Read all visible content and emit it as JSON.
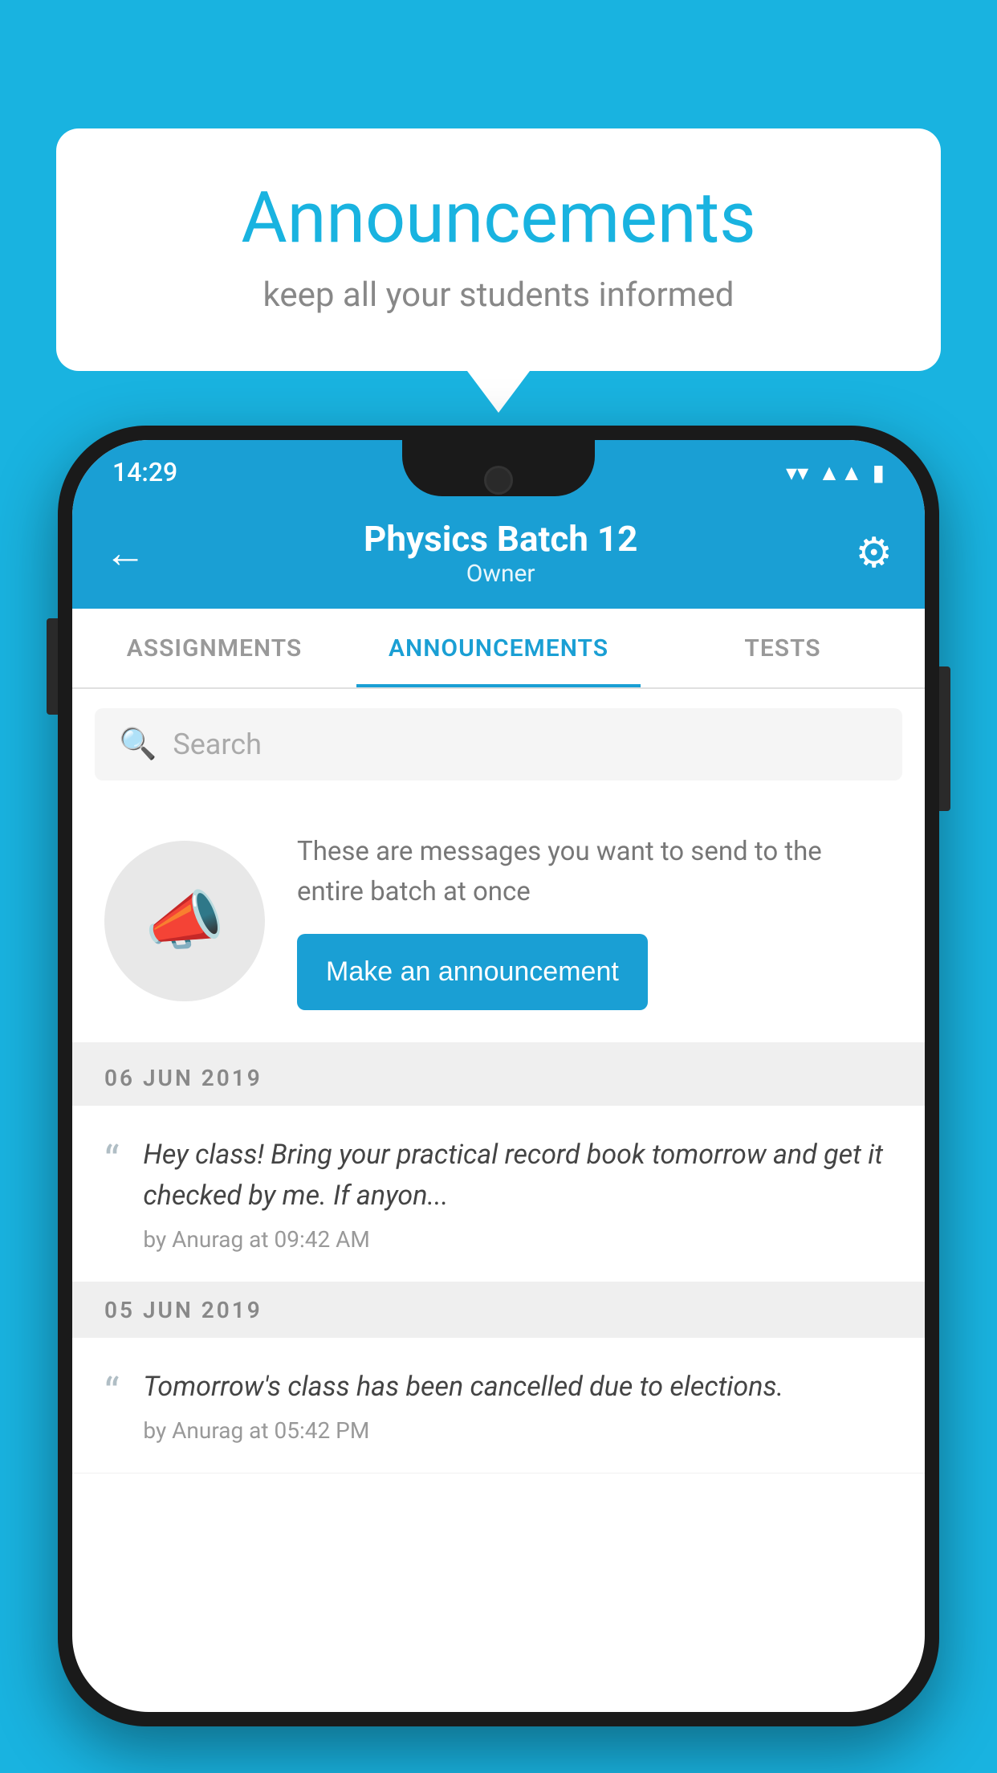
{
  "bubble": {
    "title": "Announcements",
    "subtitle": "keep all your students informed"
  },
  "phone": {
    "statusBar": {
      "time": "14:29",
      "icons": [
        "wifi",
        "signal",
        "battery"
      ]
    },
    "header": {
      "title": "Physics Batch 12",
      "subtitle": "Owner",
      "backLabel": "←",
      "gearLabel": "⚙"
    },
    "tabs": [
      {
        "label": "ASSIGNMENTS",
        "active": false
      },
      {
        "label": "ANNOUNCEMENTS",
        "active": true
      },
      {
        "label": "TESTS",
        "active": false
      }
    ],
    "search": {
      "placeholder": "Search"
    },
    "promo": {
      "text": "These are messages you want to send to the entire batch at once",
      "buttonLabel": "Make an announcement"
    },
    "announcements": [
      {
        "date": "06  JUN  2019",
        "text": "Hey class! Bring your practical record book tomorrow and get it checked by me. If anyon...",
        "author": "by Anurag at 09:42 AM"
      },
      {
        "date": "05  JUN  2019",
        "text": "Tomorrow's class has been cancelled due to elections.",
        "author": "by Anurag at 05:42 PM"
      }
    ]
  }
}
